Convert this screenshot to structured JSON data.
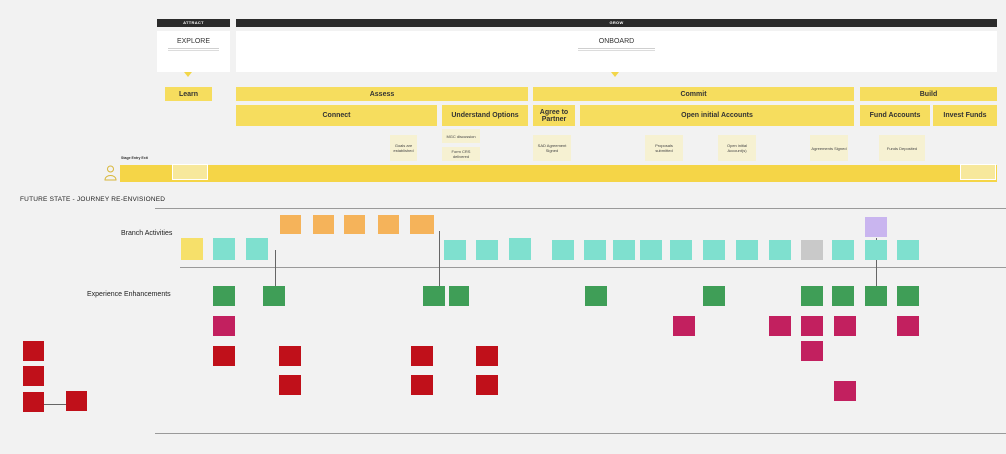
{
  "phases": {
    "attract": "ATTRACT",
    "grow": "GROW"
  },
  "stages": {
    "explore": "EXPLORE",
    "onboard": "ONBOARD"
  },
  "journey": {
    "learn": "Learn",
    "assess": "Assess",
    "commit": "Commit",
    "build": "Build",
    "connect": "Connect",
    "understand_options": "Understand Options",
    "agree_to_partner": "Agree to Partner",
    "open_initial_accounts": "Open initial Accounts",
    "fund_accounts": "Fund Accounts",
    "invest_funds": "Invest Funds"
  },
  "notes": {
    "goals": "Goals are established",
    "mgc": "MGC discussion",
    "form_crs": "Form CRS delivered",
    "sad": "SAD Agreement Signed",
    "proposals": "Proposals submitted",
    "open_initial": "Open initial Account(s)",
    "agreements": "Agreements Signed",
    "funds": "Funds Deposited"
  },
  "stage_entry_label": "Stage Entry Exit",
  "section_title": "FUTURE STATE -  JOURNEY RE-ENVISIONED",
  "lanes": {
    "branch": "Branch Activities",
    "experience": "Experience Enhancements"
  },
  "colors": {
    "phase_bar": "#2b2b2b",
    "journey_yellow": "#f6dd5e",
    "stage_strip": "#f5d547",
    "sticky_orange": "#f5b35a",
    "sticky_yellow": "#f6e06a",
    "sticky_teal": "#7fe0cf",
    "sticky_green": "#3f9e57",
    "sticky_magenta": "#c2205f",
    "sticky_red": "#c0101a",
    "sticky_gray": "#c9c9c9",
    "sticky_lavender": "#c9b5ef"
  }
}
